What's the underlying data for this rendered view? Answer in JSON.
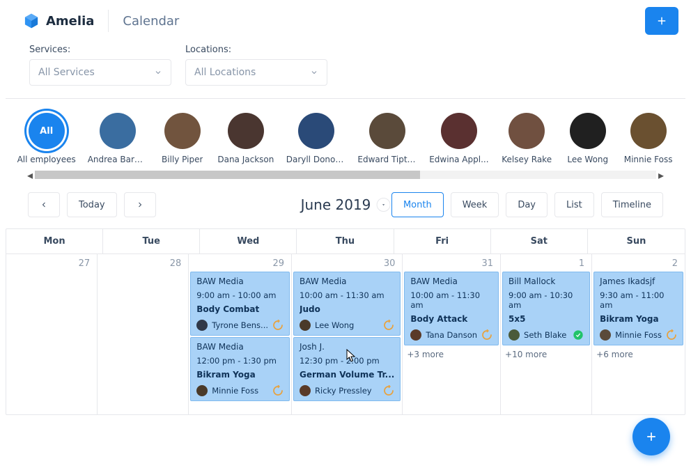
{
  "brand": "Amelia",
  "page_title": "Calendar",
  "filters": {
    "services_label": "Services:",
    "services_value": "All Services",
    "locations_label": "Locations:",
    "locations_value": "All Locations"
  },
  "employees": [
    {
      "id": "all",
      "label": "All",
      "name": "All employees"
    },
    {
      "name": "Andrea Barber"
    },
    {
      "name": "Billy Piper"
    },
    {
      "name": "Dana Jackson"
    },
    {
      "name": "Daryll Donov..."
    },
    {
      "name": "Edward Tipton"
    },
    {
      "name": "Edwina Appl..."
    },
    {
      "name": "Kelsey Rake"
    },
    {
      "name": "Lee Wong"
    },
    {
      "name": "Minnie Foss"
    }
  ],
  "toolbar": {
    "today": "Today",
    "month_label": "June 2019",
    "views": {
      "month": "Month",
      "week": "Week",
      "day": "Day",
      "list": "List",
      "timeline": "Timeline"
    }
  },
  "weekdays": [
    "Mon",
    "Tue",
    "Wed",
    "Thu",
    "Fri",
    "Sat",
    "Sun"
  ],
  "days": [
    {
      "num": "27",
      "events": [],
      "more": ""
    },
    {
      "num": "28",
      "events": [],
      "more": ""
    },
    {
      "num": "29",
      "events": [
        {
          "client": "BAW Media",
          "time": "9:00 am - 10:00 am",
          "service": "Body Combat",
          "employee": "Tyrone Bens...",
          "status": "pending"
        },
        {
          "client": "BAW Media",
          "time": "12:00 pm - 1:30 pm",
          "service": "Bikram Yoga",
          "employee": "Minnie Foss",
          "status": "pending"
        }
      ],
      "more": ""
    },
    {
      "num": "30",
      "events": [
        {
          "client": "BAW Media",
          "time": "10:00 am - 11:30 am",
          "service": "Judo",
          "employee": "Lee Wong",
          "status": "pending"
        },
        {
          "client": "Josh J.",
          "time": "12:30 pm - 2:00 pm",
          "service": "German Volume Tr...",
          "employee": "Ricky Pressley",
          "status": "pending"
        }
      ],
      "more": ""
    },
    {
      "num": "31",
      "events": [
        {
          "client": "BAW Media",
          "time": "10:00 am - 11:30 am",
          "service": "Body Attack",
          "employee": "Tana Danson",
          "status": "pending"
        }
      ],
      "more": "+3 more"
    },
    {
      "num": "1",
      "events": [
        {
          "client": "Bill Mallock",
          "time": "9:00 am - 10:30 am",
          "service": "5x5",
          "employee": "Seth Blake",
          "status": "approved"
        }
      ],
      "more": "+10 more"
    },
    {
      "num": "2",
      "events": [
        {
          "client": "James Ikadsjf",
          "time": "9:30 am - 11:00 am",
          "service": "Bikram Yoga",
          "employee": "Minnie Foss",
          "status": "pending"
        }
      ],
      "more": "+6 more"
    }
  ]
}
